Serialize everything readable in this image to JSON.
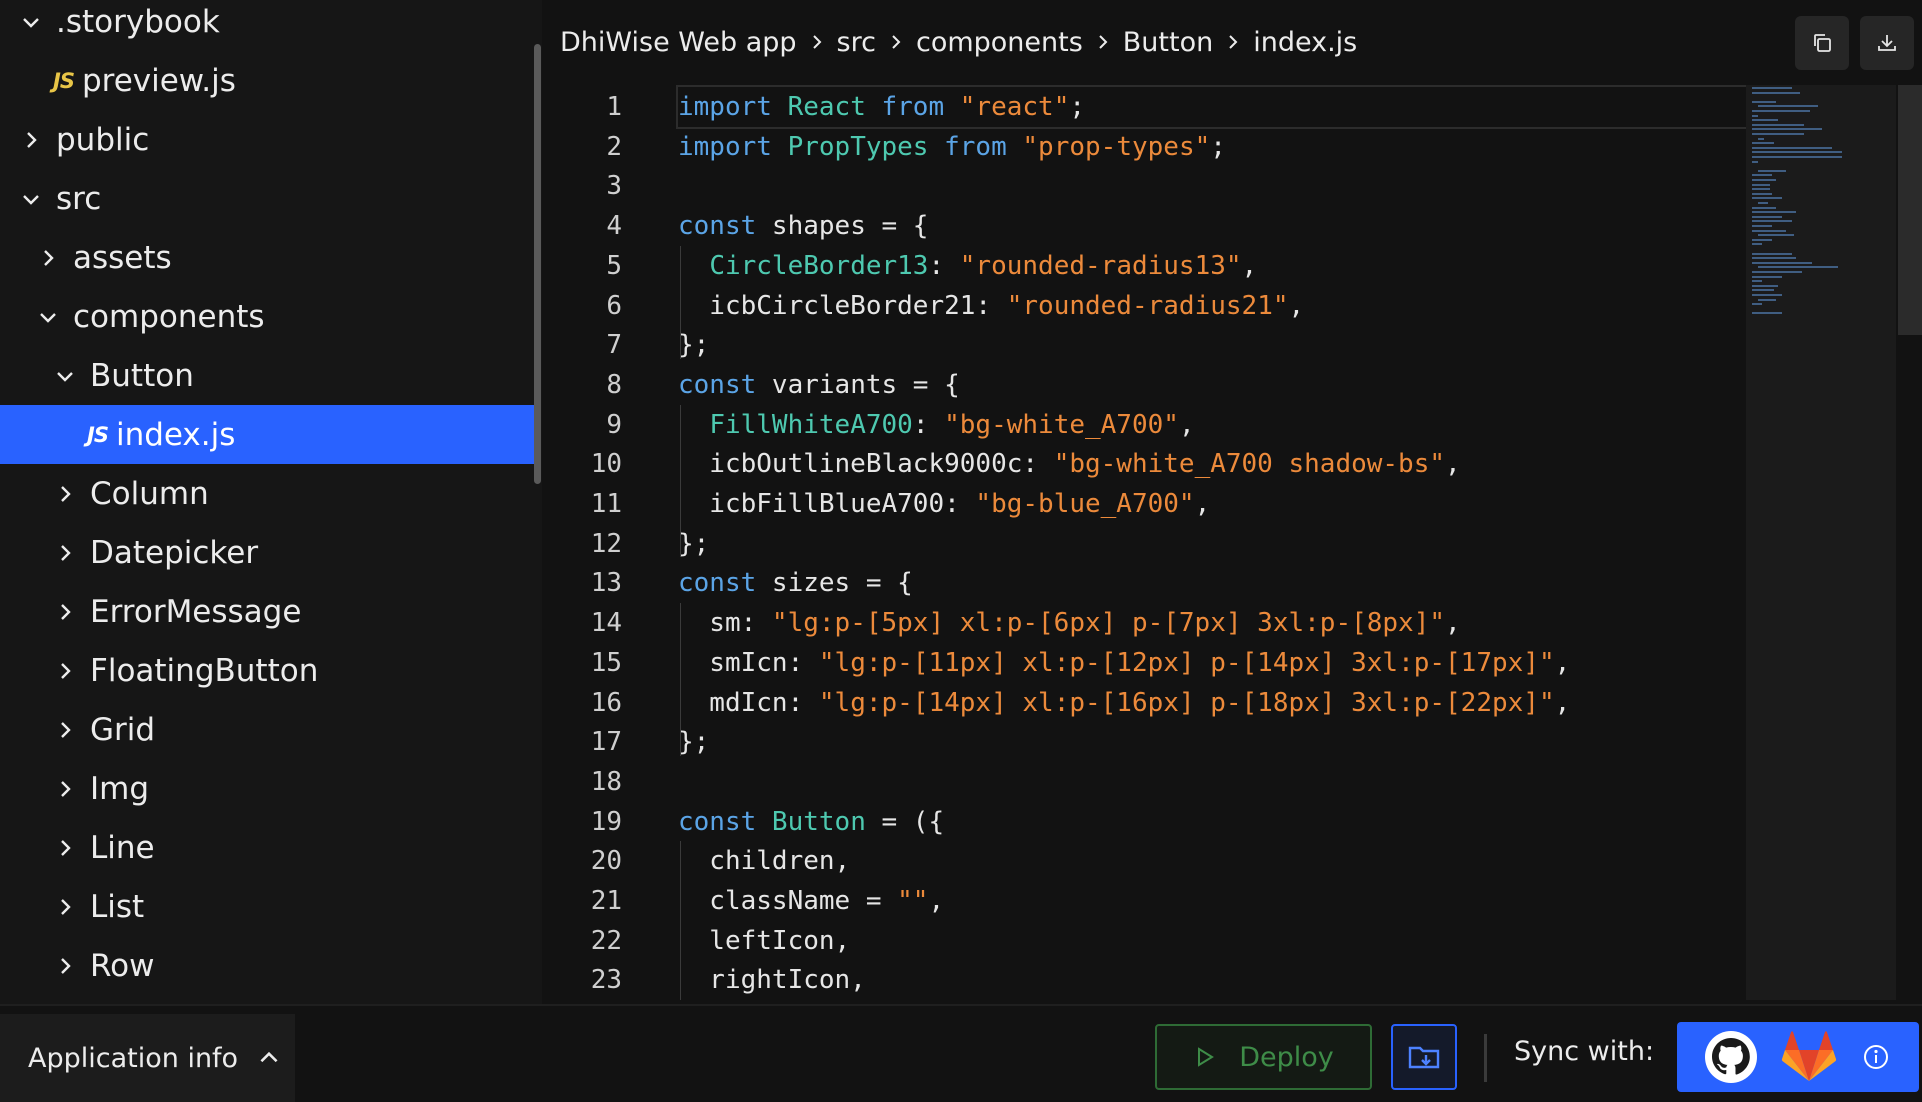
{
  "sidebar": {
    "items": [
      {
        "label": ".storybook",
        "type": "folder",
        "expanded": true
      },
      {
        "label": "preview.js",
        "type": "file",
        "badge": "JS"
      },
      {
        "label": "public",
        "type": "folder",
        "expanded": false
      },
      {
        "label": "src",
        "type": "folder",
        "expanded": true
      },
      {
        "label": "assets",
        "type": "folder",
        "expanded": false
      },
      {
        "label": "components",
        "type": "folder",
        "expanded": true
      },
      {
        "label": "Button",
        "type": "folder",
        "expanded": true
      },
      {
        "label": "index.js",
        "type": "file",
        "badge": "JS",
        "selected": true
      },
      {
        "label": "Column",
        "type": "folder",
        "expanded": false
      },
      {
        "label": "Datepicker",
        "type": "folder",
        "expanded": false
      },
      {
        "label": "ErrorMessage",
        "type": "folder",
        "expanded": false
      },
      {
        "label": "FloatingButton",
        "type": "folder",
        "expanded": false
      },
      {
        "label": "Grid",
        "type": "folder",
        "expanded": false
      },
      {
        "label": "Img",
        "type": "folder",
        "expanded": false
      },
      {
        "label": "Line",
        "type": "folder",
        "expanded": false
      },
      {
        "label": "List",
        "type": "folder",
        "expanded": false
      },
      {
        "label": "Row",
        "type": "folder",
        "expanded": false
      }
    ]
  },
  "breadcrumb": [
    "DhiWise Web app",
    "src",
    "components",
    "Button",
    "index.js"
  ],
  "toolbar": {
    "copy_icon": "copy-icon",
    "download_icon": "download-icon"
  },
  "editor": {
    "current_line": 1,
    "lines": [
      [
        [
          "kw",
          "import "
        ],
        [
          "ty",
          "React "
        ],
        [
          "kw",
          "from "
        ],
        [
          "str",
          "\"react\""
        ],
        [
          "pl",
          ";"
        ]
      ],
      [
        [
          "kw",
          "import "
        ],
        [
          "ty",
          "PropTypes "
        ],
        [
          "kw",
          "from "
        ],
        [
          "str",
          "\"prop-types\""
        ],
        [
          "pl",
          ";"
        ]
      ],
      [],
      [
        [
          "kw",
          "const "
        ],
        [
          "pl",
          "shapes = {"
        ]
      ],
      [
        [
          "pl",
          "  "
        ],
        [
          "ty",
          "CircleBorder13"
        ],
        [
          "pl",
          ": "
        ],
        [
          "str",
          "\"rounded-radius13\""
        ],
        [
          "pl",
          ","
        ]
      ],
      [
        [
          "pl",
          "  icbCircleBorder21: "
        ],
        [
          "str",
          "\"rounded-radius21\""
        ],
        [
          "pl",
          ","
        ]
      ],
      [
        [
          "pl",
          "};"
        ]
      ],
      [
        [
          "kw",
          "const "
        ],
        [
          "pl",
          "variants = {"
        ]
      ],
      [
        [
          "pl",
          "  "
        ],
        [
          "ty",
          "FillWhiteA700"
        ],
        [
          "pl",
          ": "
        ],
        [
          "str",
          "\"bg-white_A700\""
        ],
        [
          "pl",
          ","
        ]
      ],
      [
        [
          "pl",
          "  icbOutlineBlack9000c: "
        ],
        [
          "str",
          "\"bg-white_A700 shadow-bs\""
        ],
        [
          "pl",
          ","
        ]
      ],
      [
        [
          "pl",
          "  icbFillBlueA700: "
        ],
        [
          "str",
          "\"bg-blue_A700\""
        ],
        [
          "pl",
          ","
        ]
      ],
      [
        [
          "pl",
          "};"
        ]
      ],
      [
        [
          "kw",
          "const "
        ],
        [
          "pl",
          "sizes = {"
        ]
      ],
      [
        [
          "pl",
          "  sm: "
        ],
        [
          "str",
          "\"lg:p-[5px] xl:p-[6px] p-[7px] 3xl:p-[8px]\""
        ],
        [
          "pl",
          ","
        ]
      ],
      [
        [
          "pl",
          "  smIcn: "
        ],
        [
          "str",
          "\"lg:p-[11px] xl:p-[12px] p-[14px] 3xl:p-[17px]\""
        ],
        [
          "pl",
          ","
        ]
      ],
      [
        [
          "pl",
          "  mdIcn: "
        ],
        [
          "str",
          "\"lg:p-[14px] xl:p-[16px] p-[18px] 3xl:p-[22px]\""
        ],
        [
          "pl",
          ","
        ]
      ],
      [
        [
          "pl",
          "};"
        ]
      ],
      [],
      [
        [
          "kw",
          "const "
        ],
        [
          "ty",
          "Button "
        ],
        [
          "pl",
          "= ({"
        ]
      ],
      [
        [
          "pl",
          "  children,"
        ]
      ],
      [
        [
          "pl",
          "  className = "
        ],
        [
          "str",
          "\"\""
        ],
        [
          "pl",
          ","
        ]
      ],
      [
        [
          "pl",
          "  leftIcon,"
        ]
      ],
      [
        [
          "pl",
          "  rightIcon,"
        ]
      ]
    ]
  },
  "bottom": {
    "app_info_label": "Application info",
    "deploy_label": "Deploy",
    "sync_label": "Sync with:",
    "icons": [
      "chevron-up-icon",
      "play-icon",
      "folder-download-icon",
      "github-icon",
      "gitlab-icon",
      "info-icon"
    ]
  },
  "colors": {
    "accent": "#2962ff",
    "deploy_green": "#3e8c48",
    "keyword": "#5ba4e6",
    "type": "#4ec9b0",
    "string": "#ec8a3b",
    "js_badge": "#e8c547"
  }
}
